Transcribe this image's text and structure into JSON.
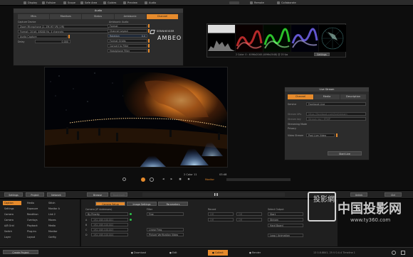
{
  "topbar": {
    "items": [
      {
        "label": "Display",
        "icon": "display-icon"
      },
      {
        "label": "Fullsize",
        "icon": "fullsize-icon"
      },
      {
        "label": "Scope",
        "icon": "scope-icon"
      },
      {
        "label": "Safe Area",
        "icon": "safe-area-icon"
      },
      {
        "label": "Guides",
        "icon": "guides-icon"
      },
      {
        "label": "Preview",
        "icon": "preview-icon"
      },
      {
        "label": "Audio",
        "icon": "audio-icon"
      },
      {
        "label": "Remote",
        "icon": "remote-icon"
      },
      {
        "label": "Collaborate",
        "icon": "collaborate-icon"
      }
    ]
  },
  "audio_panel": {
    "title": "Audio",
    "tabs": [
      "Mics",
      "Monitors",
      "Status",
      "Ambisonic",
      "Channel"
    ],
    "active_tab": "Channel",
    "capture_device_label": "Capture Device",
    "capture_device_value": "Zoom Microphone (2- ZM-H3 VR) (VR)",
    "format_value": "Format: 16 bit, 48000 Hz, 4 channels",
    "audio_capture_label": "Audio Capture",
    "delay_label": "Delay",
    "delay_value": "0",
    "delay_unit": "0.000",
    "ambisonic_title": "Ambisonic Audio",
    "ambi_rows": [
      "Format",
      "Channel Layout",
      "Rotation",
      "Format Orbits",
      "Convert to Filter",
      "Headphone Filter"
    ],
    "ambi_values": [
      "",
      "",
      "0.0",
      "",
      "",
      ""
    ],
    "brand_sub": "SENNHEISER",
    "brand": "AMBEO"
  },
  "scopes": {
    "caption": "2 Color: 0 : 4096x2048 (4096x2048) @ 25 fps",
    "button": "Settings"
  },
  "transport": {
    "timecode_label": "2 Color 11",
    "time": "03:48",
    "mode": "Monitor"
  },
  "live_stream": {
    "title": "Live Stream",
    "tabs": [
      "Channel",
      "Media",
      "Description"
    ],
    "active_tab": "Channel",
    "service_label": "Service",
    "service_value": "Facebook Live",
    "rows": [
      {
        "label": "Stream URL",
        "value": "https://facebook.com/live/stream"
      },
      {
        "label": "Stream key",
        "value": "Stream key / RTMP"
      },
      {
        "label": "Streaming Mode",
        "value": ""
      },
      {
        "label": "Privacy",
        "value": ""
      },
      {
        "label": "Video Stream",
        "value": "Post Live Video"
      }
    ],
    "start_button": "Start Live"
  },
  "bottombar": {
    "left_tabs": [
      "Settings",
      "Project",
      "Network"
    ],
    "center": [
      "Browse",
      "Bookmark"
    ],
    "right": [
      "Unlink",
      "Ctrl"
    ]
  },
  "menus": {
    "rows": [
      [
        "Caption",
        "Media",
        "Stitch"
      ],
      [
        "Settings",
        "Exposure",
        "Monitor A"
      ],
      [
        "Camera",
        "Rendition",
        "Link 2"
      ],
      [
        "Camera",
        "Overlays",
        "Moves"
      ],
      [
        "A/B Grid",
        "Playback",
        "Media"
      ],
      [
        "Switch",
        "Plug-ins",
        "Monitor"
      ],
      [
        "Layer",
        "Layout",
        "Config"
      ]
    ]
  },
  "settings": {
    "tabs": [
      "Camera Setup",
      "Image Settings",
      "Parameters"
    ],
    "camera_label": "Camera (IP Addresses)",
    "camera_value": "By Priority",
    "cam_ips": [
      {
        "id": "A",
        "ip": "192.168.100.001"
      },
      {
        "id": "B",
        "ip": "192.168.100.002"
      },
      {
        "id": "C",
        "ip": "192.168.100.003"
      },
      {
        "id": "D",
        "ip": "192.168.100.004"
      }
    ],
    "filter_label": "Filter",
    "filter_value": "Fine",
    "fps_value": "Linear Freq",
    "preview_value": "Picture Verification Video",
    "record_label": "Record",
    "record_rows": [
      "Off",
      "Off",
      "Off",
      "Off"
    ],
    "output_label": "Select Output",
    "output_rows": [
      "Start",
      "Stream",
      "Hard Board"
    ],
    "encode_label": "Loop / Animation"
  },
  "statusbar": {
    "left_button": "Create Project",
    "items": [
      "Download",
      "Edit",
      "Collect",
      "Render"
    ],
    "active": "Collect",
    "right_text": "13 0.8.8841, 25 V 0.4-4 Timeline 1"
  },
  "watermark": {
    "cn_large": "中国投影网",
    "url": "www.ty360.com",
    "seal": "投影網"
  }
}
